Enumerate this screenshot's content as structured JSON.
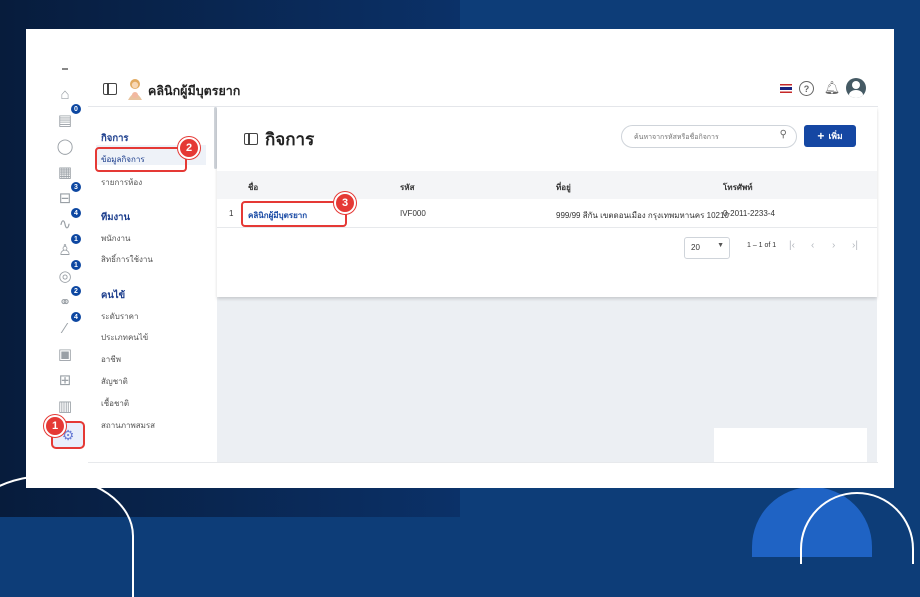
{
  "header": {
    "clinic_name": "คลินิกผู้มีบุตรยาก"
  },
  "rail": {
    "badges": [
      "0",
      "3",
      "4",
      "1",
      "1",
      "2",
      "4"
    ]
  },
  "subnav": {
    "groups": [
      {
        "title": "กิจการ",
        "items": [
          "ข้อมูลกิจการ",
          "รายการห้อง"
        ]
      },
      {
        "title": "ทีมงาน",
        "items": [
          "พนักงาน",
          "สิทธิ์การใช้งาน"
        ]
      },
      {
        "title": "คนไข้",
        "items": [
          "ระดับราคา",
          "ประเภทคนไข้",
          "อาชีพ",
          "สัญชาติ",
          "เชื้อชาติ",
          "สถานภาพสมรส"
        ]
      }
    ]
  },
  "main": {
    "title": "กิจการ",
    "search_placeholder": "ค้นหาจากรหัสหรือชื่อกิจการ",
    "add_label": "เพิ่ม",
    "columns": [
      "ชื่อ",
      "รหัส",
      "ที่อยู่",
      "โทรศัพท์"
    ],
    "rows": [
      {
        "index": "1",
        "name": "คลินิกผู้มีบุตรยาก",
        "code": "IVF000",
        "address": "999/99 สีกัน เขตดอนเมือง กรุงเทพมหานคร 10210",
        "phone": "0-2011-2233-4"
      }
    ],
    "pagination": {
      "per_page": "20",
      "range": "1 – 1 of 1"
    }
  },
  "steps": [
    "1",
    "2",
    "3"
  ],
  "colors": {
    "accent": "#1547a3",
    "highlight": "#e53935"
  }
}
